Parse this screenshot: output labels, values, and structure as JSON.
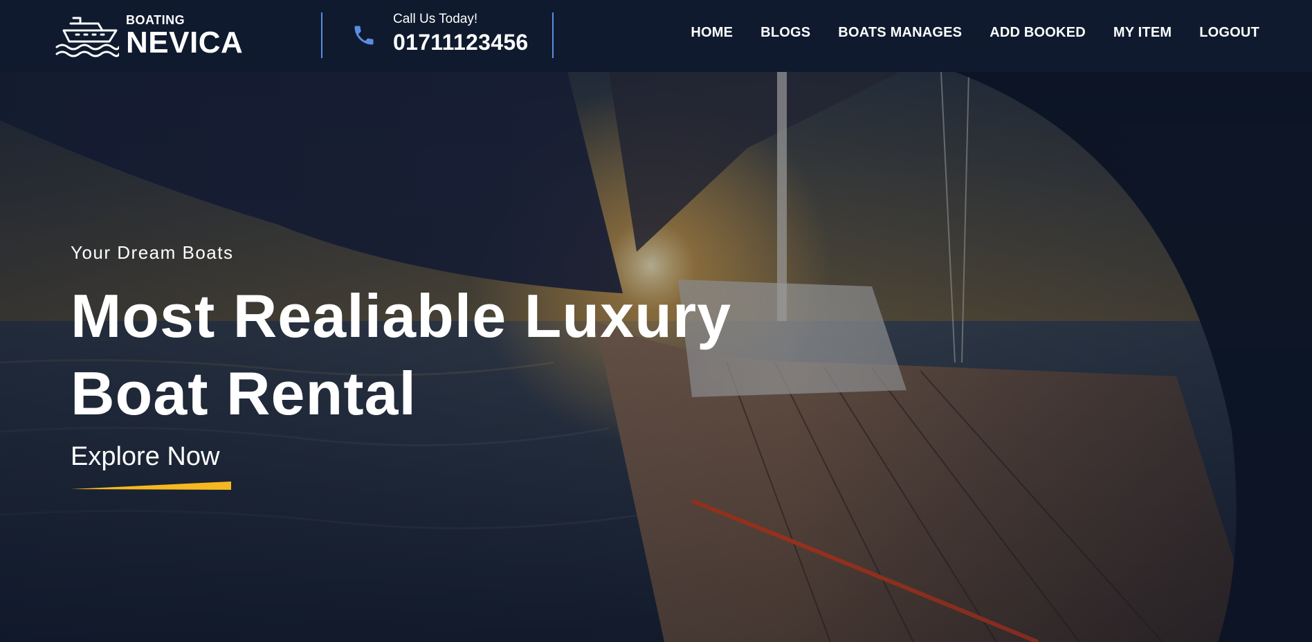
{
  "brand": {
    "small": "BOATING",
    "name": "NEVICA",
    "icon": "ship-waves-icon"
  },
  "contact": {
    "icon": "phone-icon",
    "label": "Call Us Today!",
    "phone": "01711123456"
  },
  "nav": {
    "items": [
      {
        "label": "HOME"
      },
      {
        "label": "BLOGS"
      },
      {
        "label": "BOATS MANAGES"
      },
      {
        "label": "ADD BOOKED"
      },
      {
        "label": "MY ITEM"
      },
      {
        "label": "LOGOUT"
      }
    ]
  },
  "hero": {
    "eyebrow": "Your Dream Boats",
    "title_line1": "Most Realiable Luxury",
    "title_line2": "Boat Rental",
    "cta": "Explore Now",
    "background": "sailboat-deck-sunset-photo"
  },
  "colors": {
    "navbar": "#0f1a2e",
    "accent_blue": "#5a8de0",
    "accent_yellow": "#f5b820",
    "text": "#ffffff"
  }
}
